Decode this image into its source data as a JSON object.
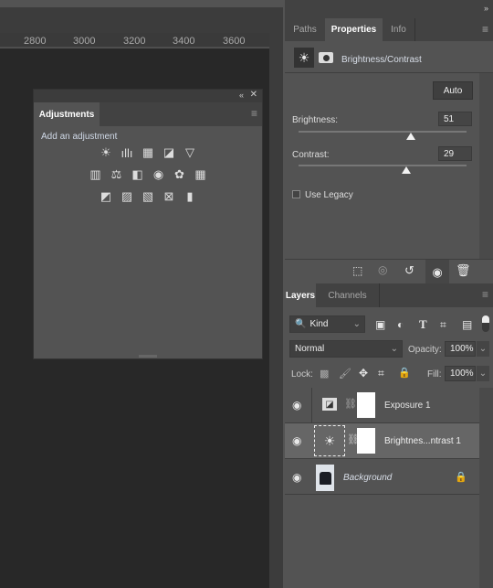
{
  "ruler": {
    "ticks": [
      "2800",
      "3000",
      "3200",
      "3400",
      "3600"
    ]
  },
  "adjustments": {
    "title": "Adjustments",
    "subtitle": "Add an adjustment",
    "rows": [
      [
        "brightness-contrast-icon",
        "levels-icon",
        "curves-icon",
        "exposure-icon",
        "vibrance-icon"
      ],
      [
        "hue-saturation-icon",
        "color-balance-icon",
        "black-white-icon",
        "photo-filter-icon",
        "channel-mixer-icon",
        "color-lookup-icon"
      ],
      [
        "invert-icon",
        "posterize-icon",
        "threshold-icon",
        "selective-color-icon",
        "gradient-map-icon"
      ]
    ],
    "glyphs": [
      [
        "☀",
        "ıllı",
        "▦",
        "◪",
        "▽"
      ],
      [
        "▥",
        "⚖",
        "◧",
        "◉",
        "✿",
        "▦"
      ],
      [
        "◩",
        "▨",
        "▧",
        "⊠",
        "▮"
      ]
    ]
  },
  "properties": {
    "tabs": [
      "Paths",
      "Properties",
      "Info"
    ],
    "active_tab": "Properties",
    "adjustment_name": "Brightness/Contrast",
    "auto_label": "Auto",
    "brightness_label": "Brightness:",
    "brightness_value": "51",
    "contrast_label": "Contrast:",
    "contrast_value": "29",
    "use_legacy_label": "Use Legacy",
    "use_legacy_checked": false
  },
  "layers": {
    "tabs": [
      "Layers",
      "Channels"
    ],
    "filter": "Kind",
    "blend_mode": "Normal",
    "opacity_label": "Opacity:",
    "opacity": "100%",
    "lock_label": "Lock:",
    "fill_label": "Fill:",
    "fill": "100%",
    "items": [
      {
        "name": "Exposure 1",
        "visible": true,
        "selected": false
      },
      {
        "name": "Brightnes...ntrast 1",
        "visible": true,
        "selected": true
      },
      {
        "name": "Background",
        "visible": true,
        "locked": true
      }
    ]
  }
}
